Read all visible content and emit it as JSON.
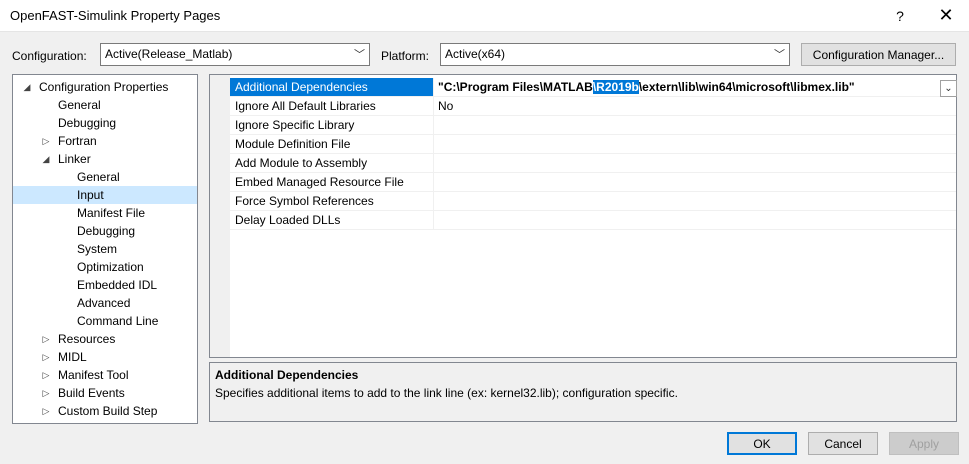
{
  "window": {
    "title": "OpenFAST-Simulink Property Pages",
    "help_glyph": "?",
    "close_glyph": "✕"
  },
  "toolbar": {
    "configuration_label": "Configuration:",
    "configuration_value": "Active(Release_Matlab)",
    "platform_label": "Platform:",
    "platform_value": "Active(x64)",
    "config_manager_label": "Configuration Manager..."
  },
  "tree": {
    "items": [
      {
        "label": "Configuration Properties",
        "expander": "◢"
      },
      {
        "label": "General",
        "expander": ""
      },
      {
        "label": "Debugging",
        "expander": ""
      },
      {
        "label": "Fortran",
        "expander": "▷"
      },
      {
        "label": "Linker",
        "expander": "◢"
      },
      {
        "label": "General",
        "expander": ""
      },
      {
        "label": "Input",
        "expander": ""
      },
      {
        "label": "Manifest File",
        "expander": ""
      },
      {
        "label": "Debugging",
        "expander": ""
      },
      {
        "label": "System",
        "expander": ""
      },
      {
        "label": "Optimization",
        "expander": ""
      },
      {
        "label": "Embedded IDL",
        "expander": ""
      },
      {
        "label": "Advanced",
        "expander": ""
      },
      {
        "label": "Command Line",
        "expander": ""
      },
      {
        "label": "Resources",
        "expander": "▷"
      },
      {
        "label": "MIDL",
        "expander": "▷"
      },
      {
        "label": "Manifest Tool",
        "expander": "▷"
      },
      {
        "label": "Build Events",
        "expander": "▷"
      },
      {
        "label": "Custom Build Step",
        "expander": "▷"
      }
    ]
  },
  "grid": {
    "rows": [
      {
        "name": "Additional Dependencies",
        "value_pre": "\"C:\\Program Files\\MATLAB",
        "value_hl": "\\R2019b",
        "value_post": "\\extern\\lib\\win64\\microsoft\\libmex.lib\""
      },
      {
        "name": "Ignore All Default Libraries",
        "value": "No"
      },
      {
        "name": "Ignore Specific Library",
        "value": ""
      },
      {
        "name": "Module Definition File",
        "value": ""
      },
      {
        "name": "Add Module to Assembly",
        "value": ""
      },
      {
        "name": "Embed Managed Resource File",
        "value": ""
      },
      {
        "name": "Force Symbol References",
        "value": ""
      },
      {
        "name": "Delay Loaded DLLs",
        "value": ""
      }
    ]
  },
  "description": {
    "title": "Additional Dependencies",
    "text": "Specifies additional items to add to the link line (ex: kernel32.lib); configuration specific."
  },
  "buttons": {
    "ok": "OK",
    "cancel": "Cancel",
    "apply": "Apply"
  },
  "icons": {
    "dropdown": "﹀",
    "grid_dropdown": "⌄"
  }
}
